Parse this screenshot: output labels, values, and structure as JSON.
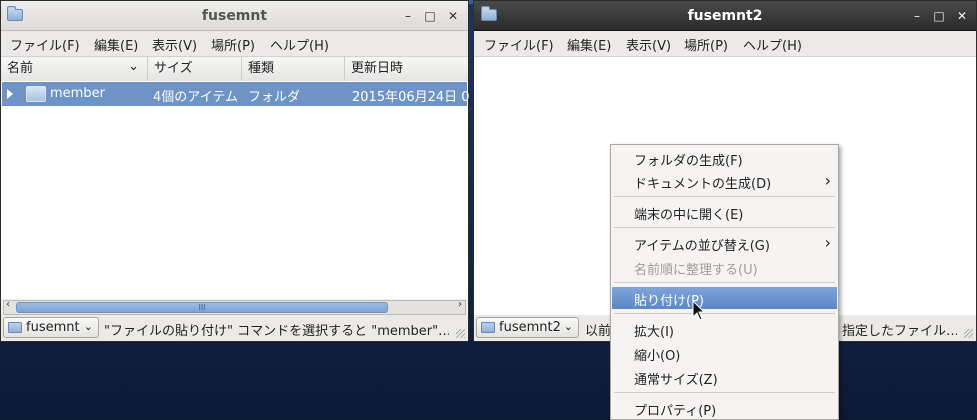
{
  "window1": {
    "title": "fusemnt",
    "controls": {
      "minimize": "–",
      "maximize": "□",
      "close": "✕"
    },
    "menu": [
      "ファイル(F)",
      "編集(E)",
      "表示(V)",
      "場所(P)",
      "ヘルプ(H)"
    ],
    "columns": [
      "名前",
      "サイズ",
      "種類",
      "更新日時"
    ],
    "sort_indicator": "⌄",
    "rows": [
      {
        "name": "member",
        "size": "4個のアイテム",
        "type": "フォルダ",
        "modified": "2015年06月24日 0",
        "expander": "collapsed"
      }
    ],
    "scrollbar": {
      "grip": "III",
      "left_arrow": "‹",
      "right_arrow": "›"
    },
    "location": "fusemnt",
    "combo_arrow": "⌄",
    "status": "\"ファイルの貼り付け\" コマンドを選択すると \"member\"…"
  },
  "window2": {
    "title": "fusemnt2",
    "controls": {
      "minimize": "–",
      "maximize": "□",
      "close": "✕"
    },
    "menu": [
      "ファイル(F)",
      "編集(E)",
      "表示(V)",
      "場所(P)",
      "ヘルプ(H)"
    ],
    "location": "fusemnt2",
    "combo_arrow": "⌄",
    "status_left": "以前",
    "status_right": "指定したファイル…"
  },
  "context_menu": {
    "items": [
      {
        "label": "フォルダの生成(F)",
        "enabled": true,
        "submenu": false
      },
      {
        "label": "ドキュメントの生成(D)",
        "enabled": true,
        "submenu": true
      },
      {
        "label": "端末の中に開く(E)",
        "enabled": true,
        "submenu": false
      },
      {
        "label": "アイテムの並び替え(G)",
        "enabled": true,
        "submenu": true
      },
      {
        "label": "名前順に整理する(U)",
        "enabled": false,
        "submenu": false
      },
      {
        "label": "貼り付け(P)",
        "enabled": true,
        "submenu": false,
        "highlighted": true
      },
      {
        "label": "拡大(I)",
        "enabled": true,
        "submenu": false
      },
      {
        "label": "縮小(O)",
        "enabled": true,
        "submenu": false
      },
      {
        "label": "通常サイズ(Z)",
        "enabled": true,
        "submenu": false
      },
      {
        "label": "プロパティ(P)",
        "enabled": true,
        "submenu": false
      }
    ],
    "submenu_arrow": "›"
  },
  "colors": {
    "selection": "#6e94c6",
    "menu_highlight": "#5b87c6",
    "desktop": "#13264a"
  }
}
